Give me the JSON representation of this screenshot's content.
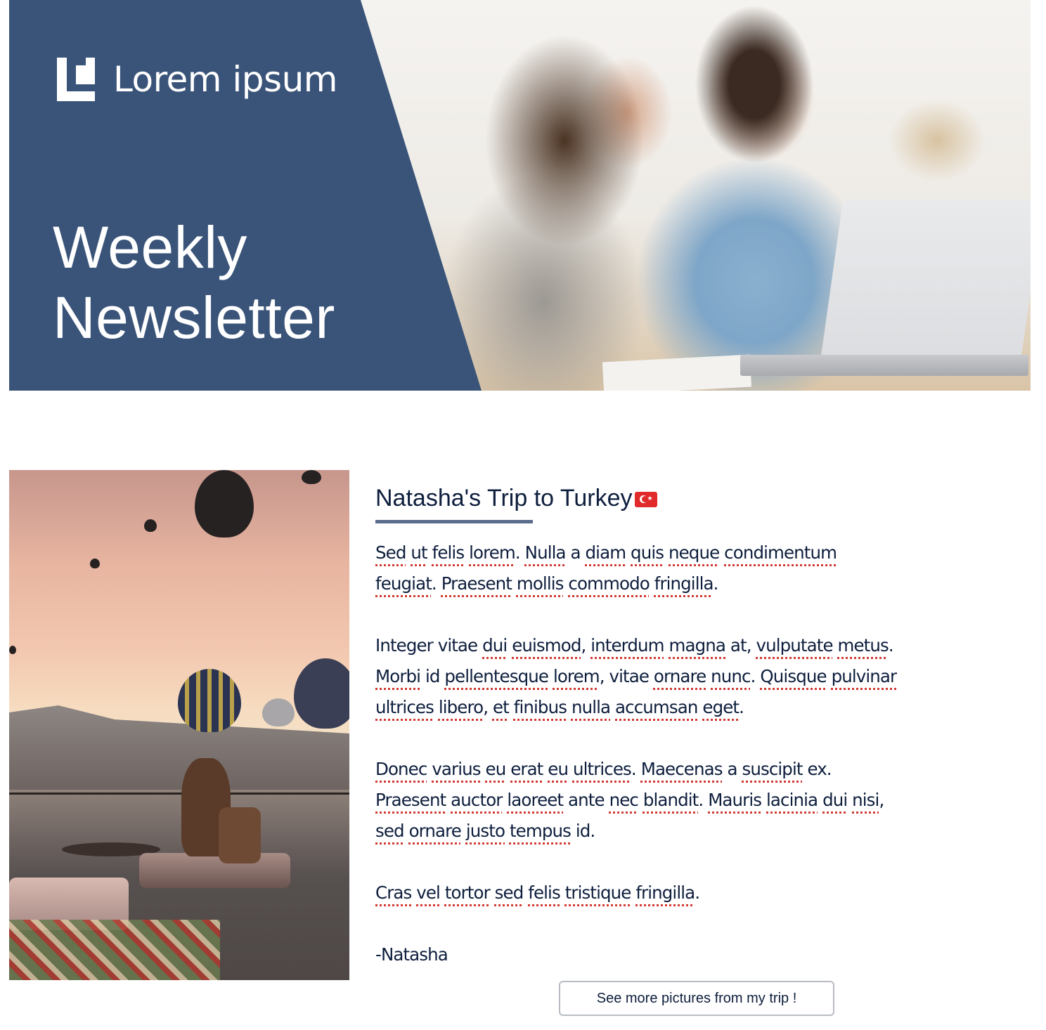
{
  "header": {
    "logo_text": "Lorem ipsum",
    "title_line1": "Weekly",
    "title_line2": "Newsletter",
    "brand_color": "#3a5479",
    "photo_description": "Smiling couple looking at a laptop"
  },
  "article": {
    "photo_description": "Woman sitting on a rooftop terrace watching hot air balloons at sunrise",
    "title": "Natasha's Trip to Turkey",
    "title_emoji": "turkey-flag-icon",
    "paragraphs": [
      [
        {
          "text": "Sed",
          "spell": true
        },
        {
          "text": " "
        },
        {
          "text": "ut",
          "spell": true
        },
        {
          "text": " "
        },
        {
          "text": "felis",
          "spell": true
        },
        {
          "text": " "
        },
        {
          "text": "lorem",
          "spell": true
        },
        {
          "text": ". "
        },
        {
          "text": "Nulla",
          "spell": true
        },
        {
          "text": " a "
        },
        {
          "text": "diam",
          "spell": true
        },
        {
          "text": " "
        },
        {
          "text": "quis",
          "spell": true
        },
        {
          "text": " "
        },
        {
          "text": "neque",
          "spell": true
        },
        {
          "text": " "
        },
        {
          "text": "condimentum",
          "spell": true
        },
        {
          "text": "\n"
        },
        {
          "text": "feugiat",
          "spell": true
        },
        {
          "text": ". "
        },
        {
          "text": "Praesent",
          "spell": true
        },
        {
          "text": " "
        },
        {
          "text": "mollis",
          "spell": true
        },
        {
          "text": " "
        },
        {
          "text": "commodo",
          "spell": true
        },
        {
          "text": " "
        },
        {
          "text": "fringilla",
          "spell": true
        },
        {
          "text": "."
        }
      ],
      [
        {
          "text": "Integer vitae "
        },
        {
          "text": "dui",
          "spell": true
        },
        {
          "text": " "
        },
        {
          "text": "euismod",
          "spell": true
        },
        {
          "text": ", "
        },
        {
          "text": "interdum",
          "spell": true
        },
        {
          "text": " "
        },
        {
          "text": "magna",
          "spell": true
        },
        {
          "text": " at, "
        },
        {
          "text": "vulputate",
          "spell": true
        },
        {
          "text": " "
        },
        {
          "text": "metus",
          "spell": true
        },
        {
          "text": ".\n"
        },
        {
          "text": "Morbi",
          "spell": true
        },
        {
          "text": " id "
        },
        {
          "text": "pellentesque",
          "spell": true
        },
        {
          "text": " "
        },
        {
          "text": "lorem",
          "spell": true
        },
        {
          "text": ", vitae "
        },
        {
          "text": "ornare",
          "spell": true
        },
        {
          "text": " "
        },
        {
          "text": "nunc",
          "spell": true
        },
        {
          "text": ". "
        },
        {
          "text": "Quisque",
          "spell": true
        },
        {
          "text": " "
        },
        {
          "text": "pulvinar",
          "spell": true
        },
        {
          "text": "\n"
        },
        {
          "text": "ultrices",
          "spell": true
        },
        {
          "text": " "
        },
        {
          "text": "libero",
          "spell": true
        },
        {
          "text": ", "
        },
        {
          "text": "et",
          "spell": true
        },
        {
          "text": " "
        },
        {
          "text": "finibus",
          "spell": true
        },
        {
          "text": " "
        },
        {
          "text": "nulla",
          "spell": true
        },
        {
          "text": " "
        },
        {
          "text": "accumsan",
          "spell": true
        },
        {
          "text": " "
        },
        {
          "text": "eget",
          "spell": true
        },
        {
          "text": "."
        }
      ],
      [
        {
          "text": "Donec",
          "spell": true
        },
        {
          "text": " "
        },
        {
          "text": "varius",
          "spell": true
        },
        {
          "text": " "
        },
        {
          "text": "eu",
          "spell": true
        },
        {
          "text": " "
        },
        {
          "text": "erat",
          "spell": true
        },
        {
          "text": " "
        },
        {
          "text": "eu",
          "spell": true
        },
        {
          "text": " "
        },
        {
          "text": "ultrices",
          "spell": true
        },
        {
          "text": ". "
        },
        {
          "text": "Maecenas",
          "spell": true
        },
        {
          "text": " a "
        },
        {
          "text": "suscipit",
          "spell": true
        },
        {
          "text": " ex.\n"
        },
        {
          "text": "Praesent",
          "spell": true
        },
        {
          "text": " "
        },
        {
          "text": "auctor",
          "spell": true
        },
        {
          "text": " "
        },
        {
          "text": "laoreet",
          "spell": true
        },
        {
          "text": " ante "
        },
        {
          "text": "nec",
          "spell": true
        },
        {
          "text": " "
        },
        {
          "text": "blandit",
          "spell": true
        },
        {
          "text": ". "
        },
        {
          "text": "Mauris",
          "spell": true
        },
        {
          "text": " "
        },
        {
          "text": "lacinia",
          "spell": true
        },
        {
          "text": " "
        },
        {
          "text": "dui",
          "spell": true
        },
        {
          "text": " "
        },
        {
          "text": "nisi",
          "spell": true
        },
        {
          "text": ",\n"
        },
        {
          "text": "sed",
          "spell": true
        },
        {
          "text": " "
        },
        {
          "text": "ornare",
          "spell": true
        },
        {
          "text": " "
        },
        {
          "text": "justo",
          "spell": true
        },
        {
          "text": " "
        },
        {
          "text": "tempus",
          "spell": true
        },
        {
          "text": " id."
        }
      ],
      [
        {
          "text": "Cras",
          "spell": true
        },
        {
          "text": " "
        },
        {
          "text": "vel",
          "spell": true
        },
        {
          "text": " "
        },
        {
          "text": "tortor",
          "spell": true
        },
        {
          "text": " "
        },
        {
          "text": "sed",
          "spell": true
        },
        {
          "text": " "
        },
        {
          "text": "felis",
          "spell": true
        },
        {
          "text": " "
        },
        {
          "text": "tristique",
          "spell": true
        },
        {
          "text": " "
        },
        {
          "text": "fringilla",
          "spell": true
        },
        {
          "text": "."
        }
      ]
    ],
    "signature": "-Natasha",
    "cta_label": "See more pictures from my trip !"
  },
  "colors": {
    "text": "#0e1e3d",
    "accent_rule": "#5a6d8c",
    "spellcheck": "#d13a33",
    "button_border": "#b8bcc2"
  }
}
